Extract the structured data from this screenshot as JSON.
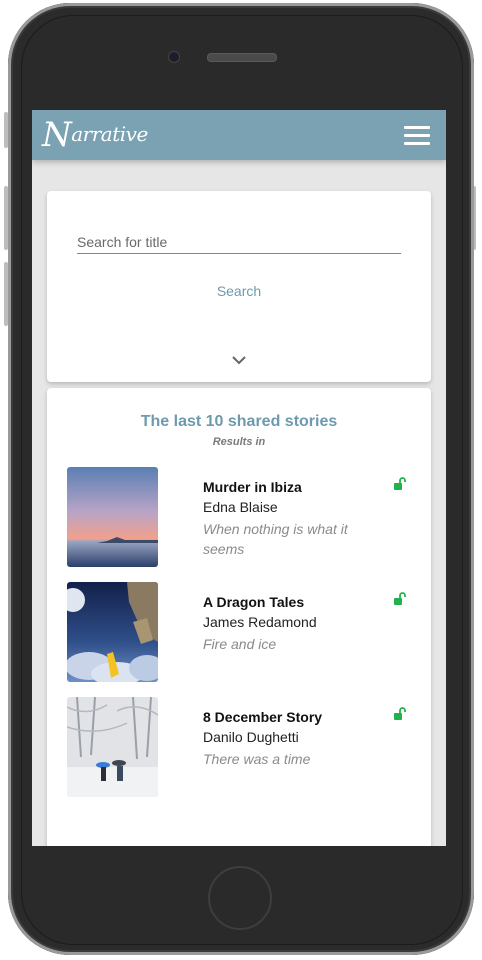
{
  "app": {
    "logo_text": "Narrative",
    "brand_color": "#7aa2b3",
    "accent_color": "#6d9aae"
  },
  "search": {
    "placeholder": "Search for title",
    "value": "",
    "button_label": "Search",
    "expand_icon": "chevron-down-icon"
  },
  "stories": {
    "title": "The last 10 shared stories",
    "subtitle": "Results in",
    "items": [
      {
        "title": "Murder in Ibiza",
        "author": "Edna Blaise",
        "description": "When nothing is what it seems",
        "status_icon": "unlocked-icon"
      },
      {
        "title": "A Dragon Tales",
        "author": "James Redamond",
        "description": "Fire and ice",
        "status_icon": "unlocked-icon"
      },
      {
        "title": "8 December Story",
        "author": "Danilo Dughetti",
        "description": "There was a time",
        "status_icon": "unlocked-icon"
      }
    ]
  },
  "status_colors": {
    "unlocked": "#22b14c"
  }
}
